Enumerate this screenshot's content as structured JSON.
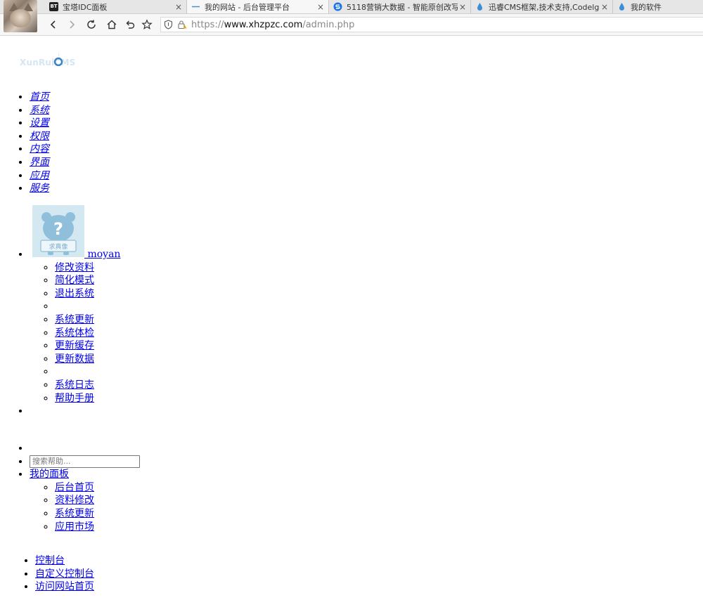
{
  "browser": {
    "tabs": [
      {
        "label": "宝塔IDC面板",
        "icon": "bt-icon",
        "active": false
      },
      {
        "label": "我的网站 - 后台管理平台",
        "icon": "loading-dash-icon",
        "active": true
      },
      {
        "label": "5118营销大数据 - 智能原创改写",
        "icon": "5118-s-icon",
        "active": false
      },
      {
        "label": "迅睿CMS框架,技术支持,Codelg",
        "icon": "drop-icon",
        "active": false
      },
      {
        "label": "我的软件",
        "icon": "drop-icon",
        "active": false
      }
    ],
    "bt_badge": "BT",
    "close_glyph": "×",
    "url": {
      "scheme": "https://",
      "host": "www.xhzpzc.com",
      "path": "/admin.php"
    }
  },
  "logo": {
    "text": "XunRuiCMS"
  },
  "top_nav": [
    "首页",
    "系统",
    "设置",
    "权限",
    "内容",
    "界面",
    "应用",
    "服务"
  ],
  "user": {
    "name": "moyan",
    "avatar_caption": "求真像",
    "menu": [
      "修改资料",
      "简化模式",
      "退出系统",
      "",
      "系统更新",
      "系统体检",
      "更新缓存",
      "更新数据",
      "",
      "系统日志",
      "帮助手册"
    ]
  },
  "search": {
    "placeholder": "搜索帮助..."
  },
  "panel": {
    "label": "我的面板",
    "items": [
      "后台首页",
      "资料修改",
      "系统更新",
      "应用市场"
    ]
  },
  "bottom_links": [
    "控制台",
    "自定义控制台",
    "访问网站首页"
  ],
  "colors": {
    "link": "#0000ee",
    "logo": "#d5e6f2",
    "avatar_bg": "#cfe5f0",
    "accent_blue": "#1a73e8"
  }
}
